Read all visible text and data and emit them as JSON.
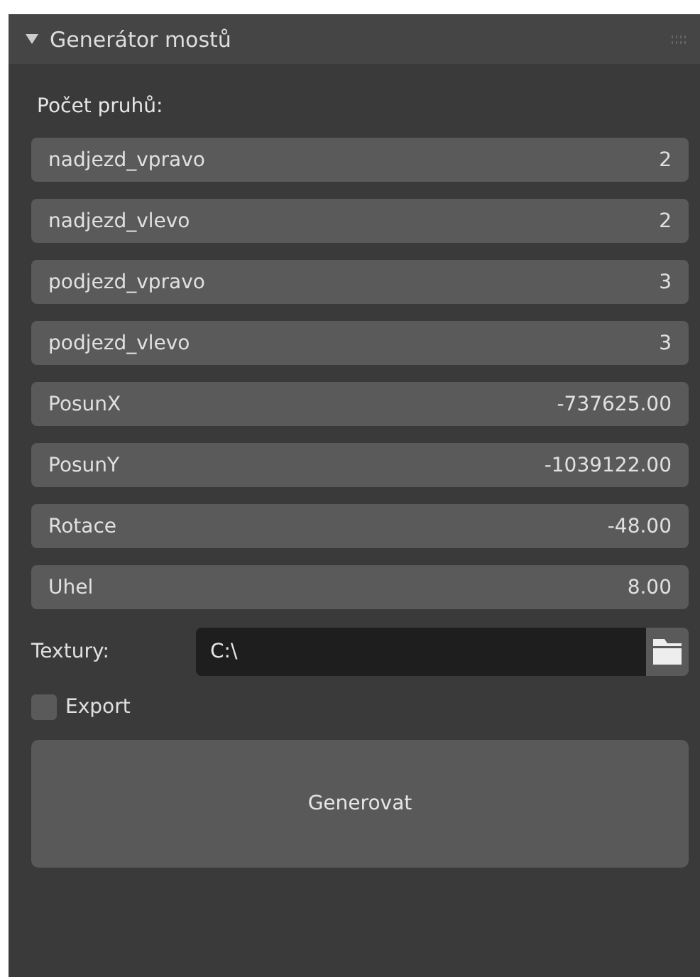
{
  "panel": {
    "title": "Generátor mostů",
    "expanded": true
  },
  "section_label": "Počet pruhů:",
  "fields": [
    {
      "label": "nadjezd_vpravo",
      "value": "2"
    },
    {
      "label": "nadjezd_vlevo",
      "value": "2"
    },
    {
      "label": "podjezd_vpravo",
      "value": "3"
    },
    {
      "label": "podjezd_vlevo",
      "value": "3"
    },
    {
      "label": "PosunX",
      "value": "-737625.00"
    },
    {
      "label": "PosunY",
      "value": "-1039122.00"
    },
    {
      "label": "Rotace",
      "value": "-48.00"
    },
    {
      "label": "Uhel",
      "value": "8.00"
    }
  ],
  "textures": {
    "label": "Textury:",
    "value": "C:\\"
  },
  "export": {
    "label": "Export",
    "checked": false
  },
  "button": "Generovat"
}
